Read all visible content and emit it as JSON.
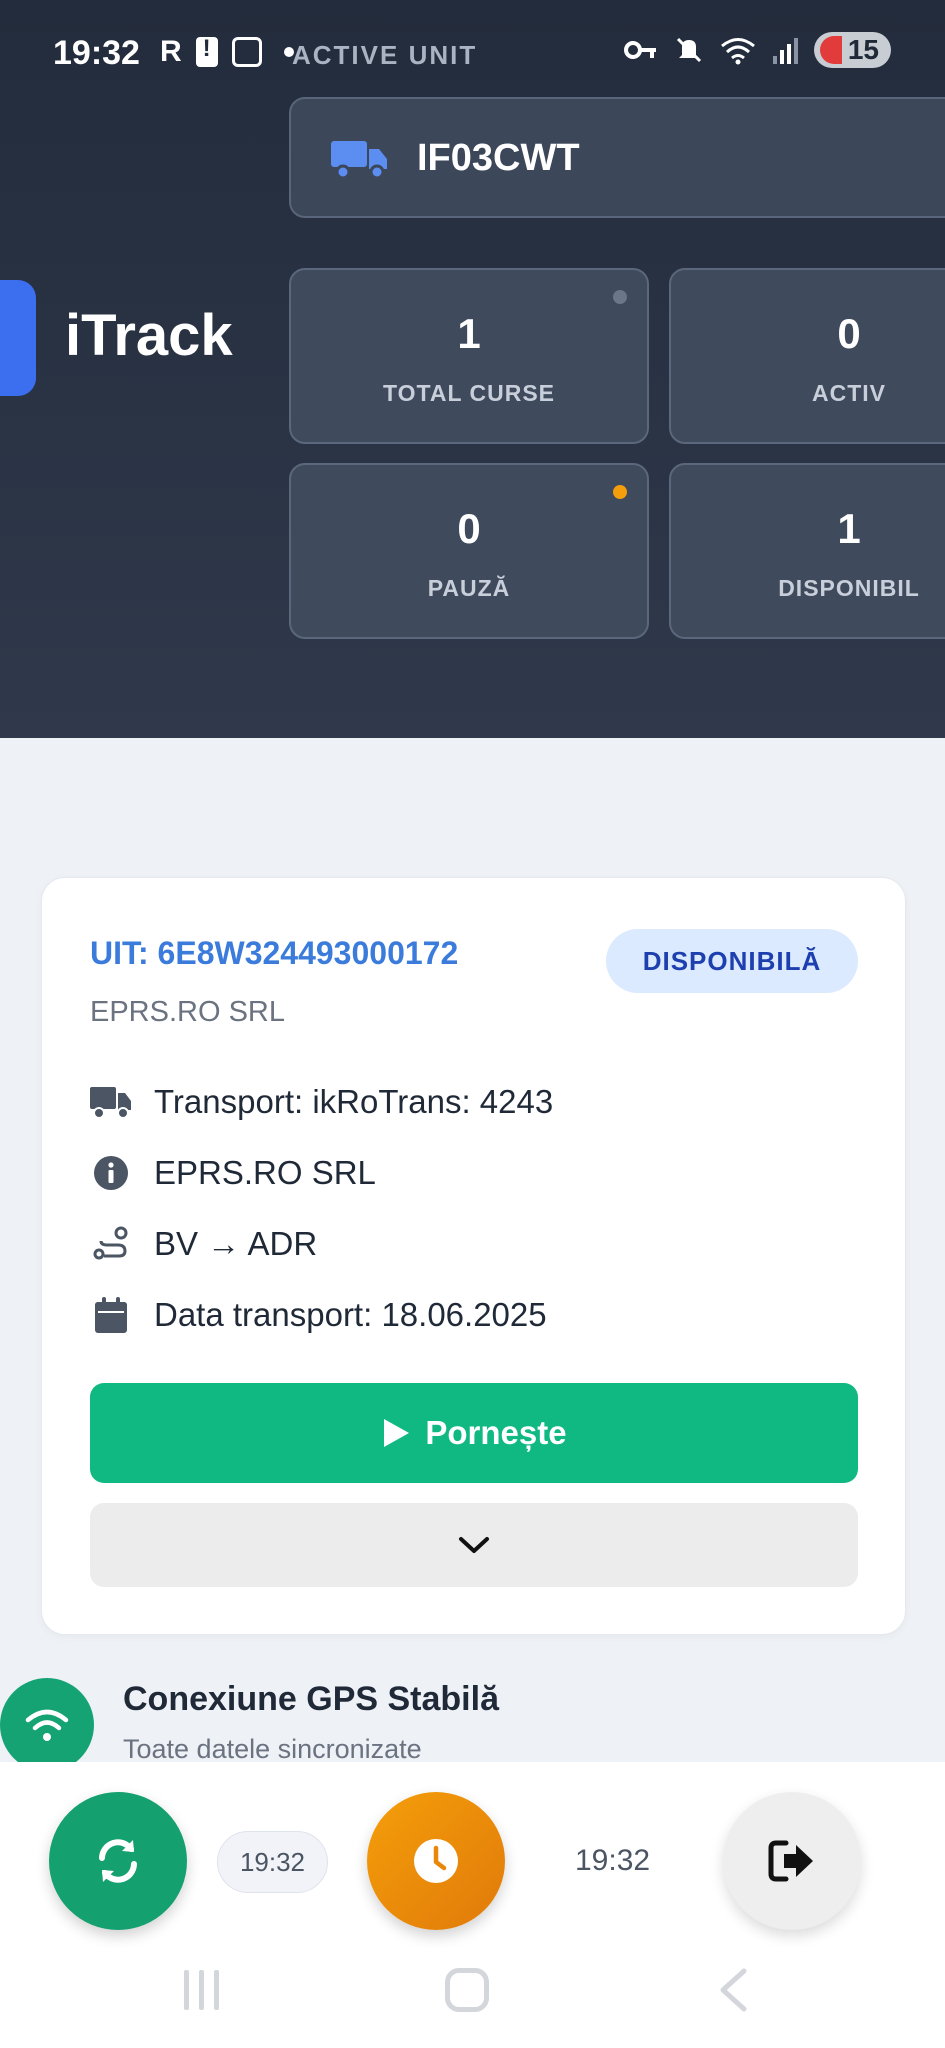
{
  "status_bar": {
    "time": "19:32",
    "carrier_icon_label": "R",
    "battery_level": "15",
    "icons": [
      "alert-icon",
      "screenshot-icon",
      "vpn-key-icon",
      "mute-icon",
      "wifi-icon",
      "signal-icon",
      "battery-icon"
    ]
  },
  "header": {
    "section_label": "ACTIVE UNIT",
    "vehicle_plate": "IF03CWT",
    "brand": "iTrack",
    "stats": [
      {
        "value": "1",
        "label": "TOTAL CURSE",
        "indicator_color": "#6b7688"
      },
      {
        "value": "0",
        "label": "ACTIV"
      },
      {
        "value": "0",
        "label": "PAUZĂ",
        "indicator_color": "#f59e0b"
      },
      {
        "value": "1",
        "label": "DISPONIBIL"
      }
    ]
  },
  "trip": {
    "uit": "UIT: 6E8W324493000172",
    "status_badge": "DISPONIBILĂ",
    "company": "EPRS.RO SRL",
    "details": [
      {
        "icon": "truck-icon",
        "text": "Transport: ikRoTrans: 4243"
      },
      {
        "icon": "info-icon",
        "text": "EPRS.RO SRL"
      },
      {
        "icon": "route-icon",
        "text": "BV → ADR"
      },
      {
        "icon": "calendar-icon",
        "text": "Data transport: 18.06.2025"
      }
    ],
    "start_button_label": "Pornește",
    "expand_icon": "chevron-down-icon"
  },
  "gps": {
    "title": "Conexiune GPS Stabilă",
    "subtitle": "Toate datele sincronizate"
  },
  "bottom_bar": {
    "sync_time": "19:32",
    "clock_time": "19:32"
  },
  "colors": {
    "header_bg": "#232c3c",
    "accent_blue": "#3b7bdb",
    "start_green": "#10b981",
    "clock_orange": "#f59e0b"
  }
}
